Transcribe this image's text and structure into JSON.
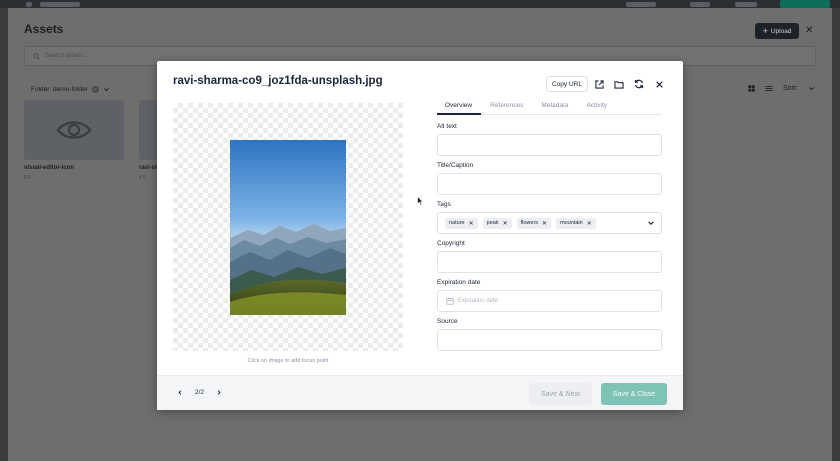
{
  "assets": {
    "title": "Assets",
    "upload_label": "Upload",
    "search_placeholder": "Search assets...",
    "folder_label": "Folder: demo-folder",
    "sort_label": "Sort:",
    "cards": [
      {
        "name": "visual-editor-icon",
        "ext": "jpg"
      },
      {
        "name": "ravi-sh",
        "ext": "jpg"
      }
    ]
  },
  "modal": {
    "title": "ravi-sharma-co9_joz1fda-unsplash.jpg",
    "copy_url_label": "Copy URL",
    "preview_hint": "Click on image to add focus point",
    "tabs": [
      "Overview",
      "References",
      "Metadata",
      "Activity"
    ],
    "active_tab": "Overview",
    "fields": {
      "alt_text_label": "Alt text",
      "alt_text_value": "",
      "title_caption_label": "Title/Caption",
      "title_caption_value": "",
      "tags_label": "Tags",
      "tags": [
        "nature",
        "peak",
        "flowers",
        "mountain"
      ],
      "copyright_label": "Copyright",
      "copyright_value": "",
      "expiration_label": "Expiration date",
      "expiration_placeholder": "Expiration date",
      "source_label": "Source",
      "source_value": ""
    },
    "footer": {
      "page_indicator": "2/2",
      "save_next_label": "Save & Next",
      "save_close_label": "Save & Close"
    }
  },
  "colors": {
    "accent": "#7fc2b6",
    "text_dark": "#1b243f",
    "overlay": "#6e6e6e"
  }
}
